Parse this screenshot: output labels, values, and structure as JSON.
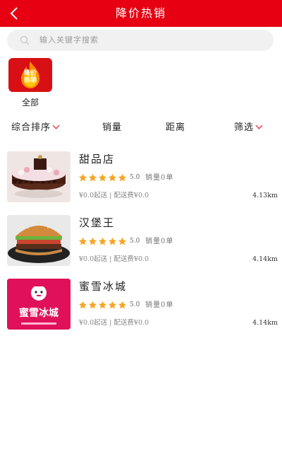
{
  "header": {
    "title": "降价热销"
  },
  "search": {
    "placeholder": "输入关键字搜索"
  },
  "category": {
    "label": "全部",
    "badge_line1": "降价",
    "badge_line2": "热销"
  },
  "sort": {
    "comprehensive": "综合排序",
    "sales": "销量",
    "distance": "距离",
    "filter": "筛选"
  },
  "shops": [
    {
      "name": "甜品店",
      "rating": "5.0",
      "sales": "销量0单",
      "min_order": "¥0.0起送",
      "delivery_fee": "配送费¥0.0",
      "distance": "4.13km"
    },
    {
      "name": "汉堡王",
      "rating": "5.0",
      "sales": "销量0单",
      "min_order": "¥0.0起送",
      "delivery_fee": "配送费¥0.0",
      "distance": "4.14km"
    },
    {
      "name": "蜜雪冰城",
      "rating": "5.0",
      "sales": "销量0单",
      "min_order": "¥0.0起送",
      "delivery_fee": "配送费¥0.0",
      "distance": "4.14km",
      "logo_text": "蜜雪冰城"
    }
  ],
  "colors": {
    "brand_red": "#e60012",
    "star_orange": "#f5a623"
  }
}
